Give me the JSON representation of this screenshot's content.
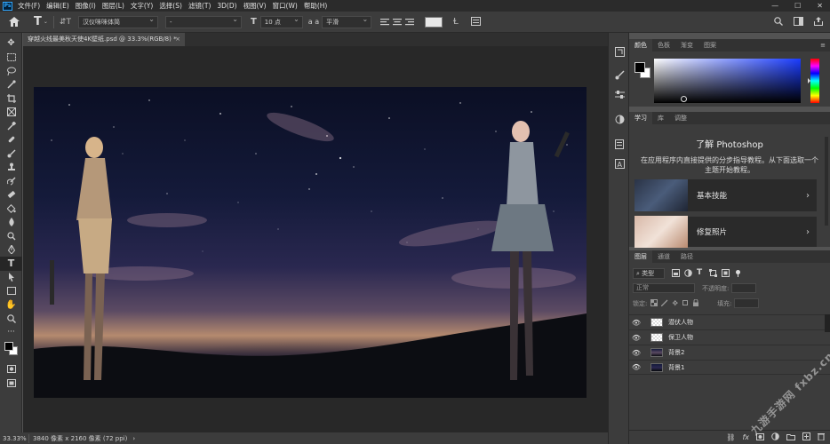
{
  "app": {
    "logo_text": "Ps"
  },
  "menu": [
    "文件(F)",
    "编辑(E)",
    "图像(I)",
    "图层(L)",
    "文字(Y)",
    "选择(S)",
    "滤镜(T)",
    "3D(D)",
    "视图(V)",
    "窗口(W)",
    "帮助(H)"
  ],
  "window_controls": {
    "minimize": "—",
    "restore": "☐",
    "close": "✕"
  },
  "options": {
    "font_family": "汉仪咪咪体简",
    "font_style": "-",
    "font_size": "10 点",
    "aa_label": "a a",
    "antialias": "平滑"
  },
  "doc": {
    "tab_title": "穿越火线最美秋天使4K壁纸.psd @ 33.3%(RGB/8) *",
    "close": "×"
  },
  "status": {
    "zoom": "33.33%",
    "info": "3840 像素 x 2160 像素 (72 ppi)",
    "arrow": "›"
  },
  "color_panel": {
    "tabs": [
      "颜色",
      "色板",
      "渐变",
      "图案"
    ],
    "menu": "≡"
  },
  "learn_panel": {
    "tabs": [
      "学习",
      "库",
      "调整"
    ],
    "title": "了解 Photoshop",
    "description": "在应用程序内直接提供的分步指导教程。从下面选取一个主题开始教程。",
    "cards": [
      {
        "label": "基本技能"
      },
      {
        "label": "修复照片"
      }
    ],
    "chevron": "›"
  },
  "layers_panel": {
    "tabs": [
      "图层",
      "通道",
      "路径"
    ],
    "kind_label": "类型",
    "blend_mode": "正常",
    "opacity_label": "不透明度:",
    "lock_label": "锁定:",
    "fill_label": "填充:",
    "layers": [
      {
        "name": "潜伏人物",
        "visible": true
      },
      {
        "name": "保卫人物",
        "visible": true
      },
      {
        "name": "背景2",
        "visible": true
      },
      {
        "name": "背景1",
        "visible": true
      }
    ],
    "footer_icons": [
      "link-icon",
      "fx-icon",
      "mask-icon",
      "adjustment-icon",
      "group-icon",
      "new-layer-icon",
      "delete-icon"
    ]
  },
  "watermark": "九游手游网 fxbz.cn"
}
